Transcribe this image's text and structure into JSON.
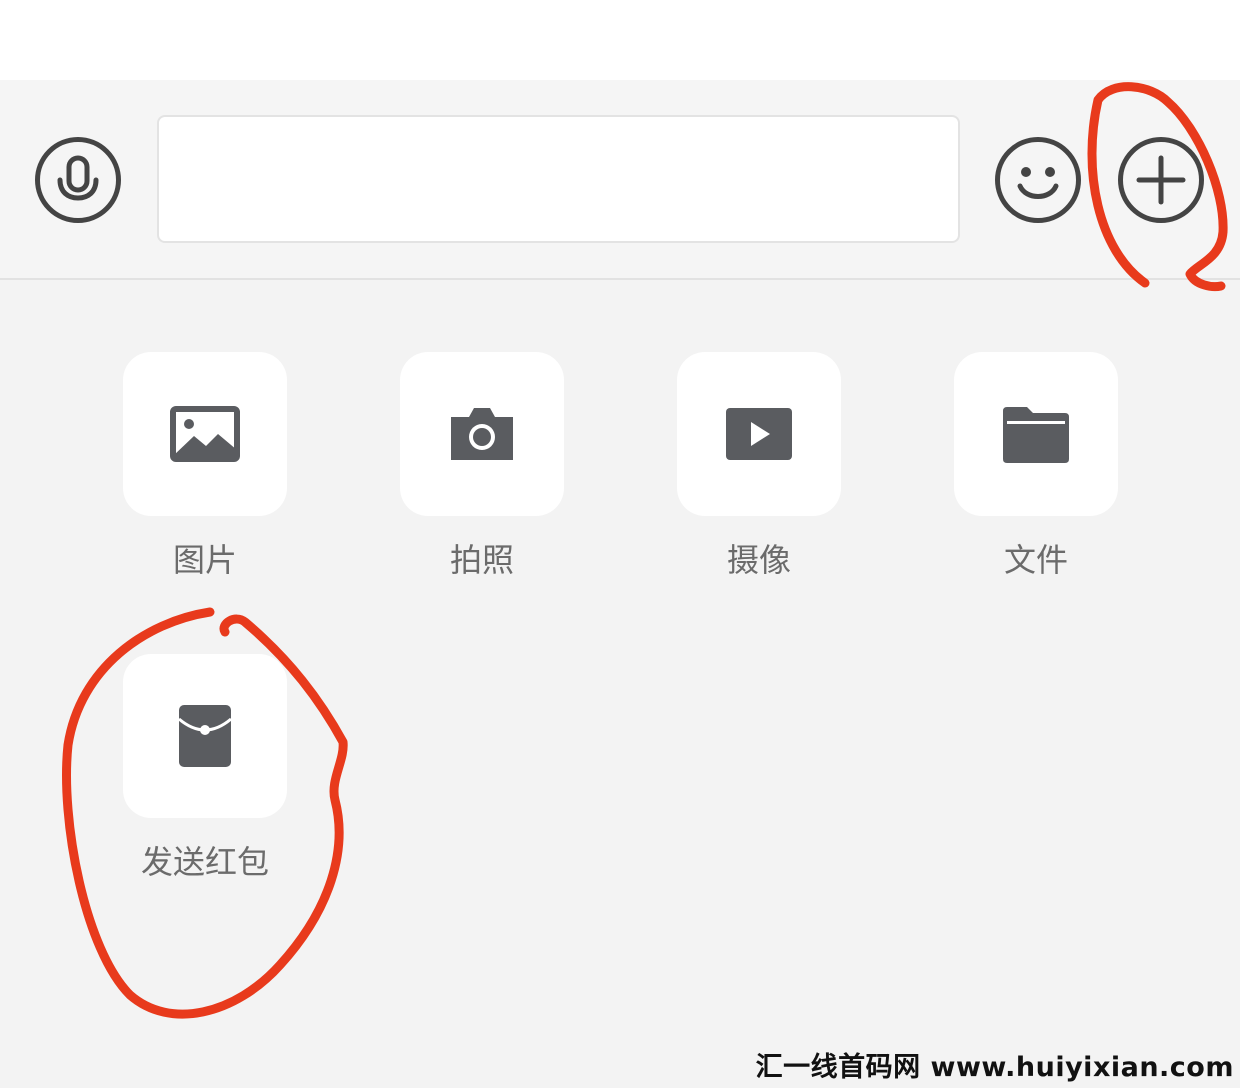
{
  "input_bar": {
    "voice_icon": "microphone-icon",
    "message_value": "",
    "emoji_icon": "smiley-icon",
    "plus_icon": "plus-circle-icon"
  },
  "more_panel": {
    "items": [
      {
        "label": "图片",
        "icon": "image-icon"
      },
      {
        "label": "拍照",
        "icon": "camera-icon"
      },
      {
        "label": "摄像",
        "icon": "video-icon"
      },
      {
        "label": "文件",
        "icon": "folder-icon"
      },
      {
        "label": "发送红包",
        "icon": "red-packet-icon"
      }
    ]
  },
  "watermark": {
    "text": "汇一线首码网 www.huiyixian.com"
  },
  "colors": {
    "panel_bg": "#f3f3f3",
    "icon": "#5a5c60",
    "label": "#6b6b6b",
    "annotation": "#e83a1c"
  }
}
